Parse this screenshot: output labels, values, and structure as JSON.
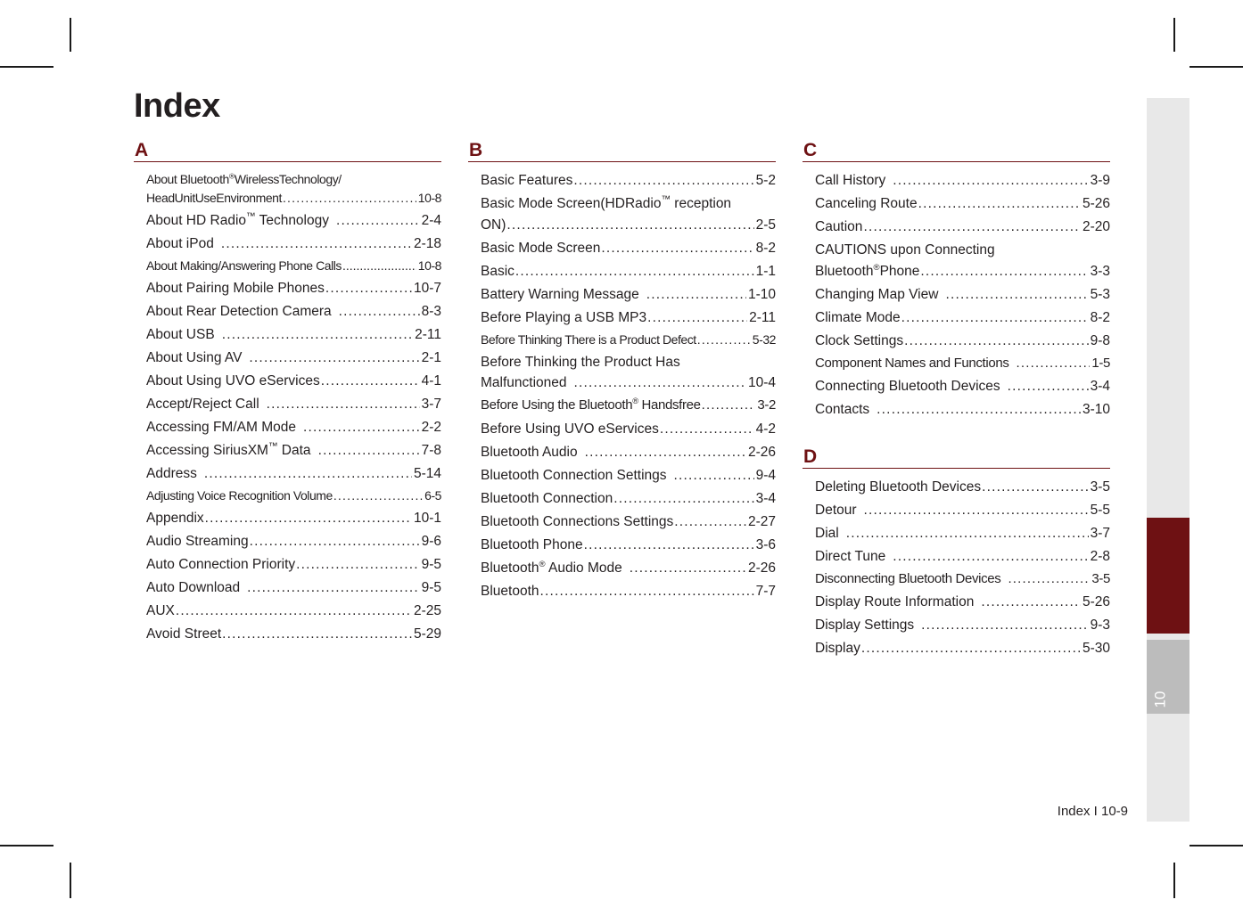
{
  "page": {
    "title": "Index",
    "footer": "Index I 10-9",
    "accent_color": "#6e1113",
    "text_color": "#231f20",
    "tab_number": "10",
    "tab_rail_color": "#e8e8e8",
    "tab_current_color": "#6e1113",
    "tab_next_color": "#bcbcbc"
  },
  "columns": [
    {
      "groups": [
        {
          "letter": "A",
          "entries": [
            {
              "label": "About Bluetooth",
              "sup": "®",
              "label2": "WirelessTechnology/",
              "line2": "HeadUnitUseEnvironment",
              "page": "10-8",
              "wrap": true,
              "condensed": true
            },
            {
              "label": "About HD Radio",
              "tm": "™",
              "label2": " Technology",
              "page": "2-4",
              "gap": true
            },
            {
              "label": "About iPod",
              "page": "2-18",
              "gap": true
            },
            {
              "label": "About Making/Answering Phone Calls",
              "page": "10-8",
              "noleader": true,
              "condensed": true
            },
            {
              "label": "About Pairing Mobile Phones",
              "page": "10-7"
            },
            {
              "label": "About Rear Detection Camera",
              "page": "8-3",
              "gap": true
            },
            {
              "label": "About USB",
              "page": "2-11",
              "gap": true
            },
            {
              "label": "About Using AV",
              "page": "2-1",
              "gap": true
            },
            {
              "label": "About Using UVO eServices",
              "page": "4-1"
            },
            {
              "label": "Accept/Reject Call",
              "page": "3-7",
              "gap": true
            },
            {
              "label": "Accessing FM/AM Mode",
              "page": "2-2",
              "gap": true
            },
            {
              "label": "Accessing SiriusXM",
              "tm": "™",
              "label2": " Data",
              "page": "7-8",
              "gap": true
            },
            {
              "label": "Address",
              "page": "5-14",
              "gap": true
            },
            {
              "label": "Adjusting Voice Recognition Volume",
              "page": "6-5",
              "condensed": true
            },
            {
              "label": "Appendix",
              "page": "10-1"
            },
            {
              "label": "Audio Streaming",
              "page": "9-6"
            },
            {
              "label": "Auto Connection Priority",
              "page": "9-5"
            },
            {
              "label": "Auto Download",
              "page": "9-5",
              "gap": true
            },
            {
              "label": "AUX",
              "page": "2-25"
            },
            {
              "label": "Avoid Street",
              "page": "5-29"
            }
          ]
        }
      ]
    },
    {
      "groups": [
        {
          "letter": "B",
          "entries": [
            {
              "label": "Basic Features",
              "page": "5-2"
            },
            {
              "label": "Basic Mode Screen(HDRadio",
              "tm": "™",
              "label2": "  reception",
              "line2": "ON)",
              "page": "2-5",
              "wrap": true
            },
            {
              "label": "Basic Mode Screen",
              "page": "8-2"
            },
            {
              "label": "Basic",
              "page": "1-1"
            },
            {
              "label": "Battery Warning Message",
              "page": "1-10",
              "gap": true
            },
            {
              "label": "Before Playing a USB MP3",
              "page": "2-11"
            },
            {
              "label": "Before Thinking There is a Product Defect",
              "page": "5-32",
              "condensed": true
            },
            {
              "label": "Before Thinking the Product Has",
              "line2": "Malfunctioned",
              "page": "10-4",
              "wrap": true,
              "gap": true
            },
            {
              "label": "Before Using the Bluetooth",
              "sup": "®",
              "label2": " Handsfree",
              "page": "3-2",
              "condensed2": true
            },
            {
              "label": "Before Using UVO eServices",
              "page": "4-2"
            },
            {
              "label": "Bluetooth Audio",
              "page": "2-26",
              "gap": true
            },
            {
              "label": "Bluetooth Connection Settings",
              "page": "9-4",
              "gap": true
            },
            {
              "label": "Bluetooth Connection",
              "page": "3-4"
            },
            {
              "label": "Bluetooth Connections Settings",
              "page": "2-27"
            },
            {
              "label": "Bluetooth Phone",
              "page": "3-6"
            },
            {
              "label": "Bluetooth",
              "sup": "®",
              "label2": " Audio Mode",
              "page": "2-26",
              "gap": true
            },
            {
              "label": "Bluetooth",
              "page": "7-7"
            }
          ]
        }
      ]
    },
    {
      "groups": [
        {
          "letter": "C",
          "entries": [
            {
              "label": "Call History",
              "page": "3-9",
              "gap": true
            },
            {
              "label": "Canceling Route",
              "page": "5-26"
            },
            {
              "label": "Caution",
              "page": "2-20"
            },
            {
              "label": "CAUTIONS upon Connecting",
              "line2": "Bluetooth",
              "line2sup": "®",
              "line2b": "Phone",
              "page": "3-3",
              "wrap": true
            },
            {
              "label": "Changing Map View",
              "page": "5-3",
              "gap": true
            },
            {
              "label": "Climate  Mode",
              "page": "8-2"
            },
            {
              "label": "Clock Settings",
              "page": "9-8"
            },
            {
              "label": "Component Names and Functions",
              "page": "1-5",
              "gap": true,
              "condensed2": true
            },
            {
              "label": "Connecting Bluetooth Devices",
              "page": "3-4",
              "gap": true
            },
            {
              "label": "Contacts",
              "page": "3-10",
              "gap": true
            }
          ]
        },
        {
          "letter": "D",
          "entries": [
            {
              "label": "Deleting Bluetooth Devices",
              "page": "3-5"
            },
            {
              "label": "Detour",
              "page": "5-5",
              "gap": true
            },
            {
              "label": "Dial",
              "page": "3-7",
              "gap": true
            },
            {
              "label": "Direct Tune",
              "page": "2-8",
              "gap": true
            },
            {
              "label": "Disconnecting Bluetooth Devices",
              "page": "3-5",
              "gap": true,
              "condensed2": true
            },
            {
              "label": "Display Route Information",
              "page": "5-26",
              "gap": true
            },
            {
              "label": "Display Settings",
              "page": "9-3",
              "gap": true
            },
            {
              "label": "Display",
              "page": "5-30"
            }
          ]
        }
      ]
    }
  ]
}
